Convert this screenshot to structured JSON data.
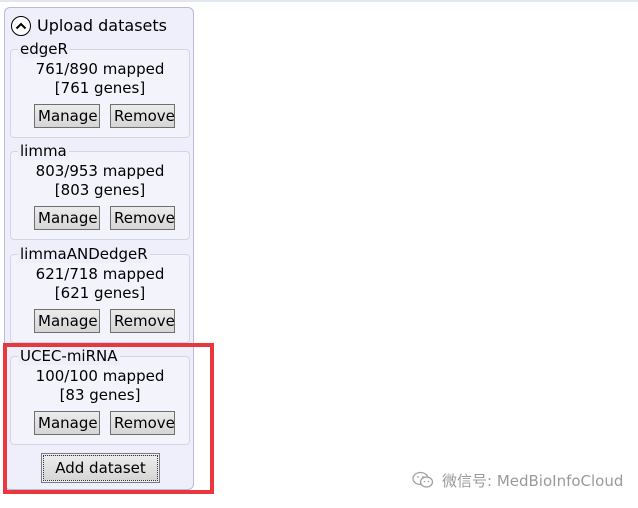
{
  "panel": {
    "title": "Upload datasets",
    "datasets": [
      {
        "name": "edgeR",
        "mapped": "761/890 mapped",
        "genes": "[761 genes]"
      },
      {
        "name": "limma",
        "mapped": "803/953 mapped",
        "genes": "[803 genes]"
      },
      {
        "name": "limmaANDedgeR",
        "mapped": "621/718 mapped",
        "genes": "[621 genes]"
      },
      {
        "name": "UCEC-miRNA",
        "mapped": "100/100 mapped",
        "genes": "[83 genes]"
      }
    ],
    "manage_label": "Manage",
    "remove_label": "Remove",
    "add_label": "Add dataset"
  },
  "watermark": {
    "text": "微信号: MedBioInfoCloud"
  },
  "colors": {
    "panel_bg": "#efeffb",
    "highlight": "#e8383d"
  }
}
